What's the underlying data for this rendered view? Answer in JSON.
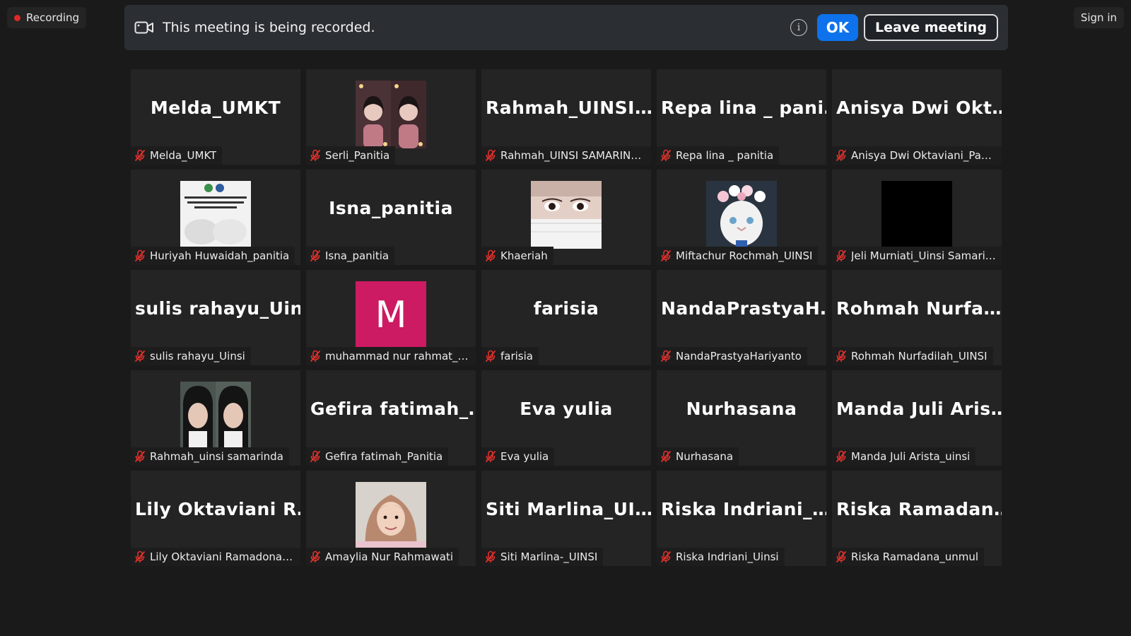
{
  "recording_indicator": {
    "label": "Recording"
  },
  "sign_in": {
    "label": "Sign in"
  },
  "banner": {
    "message": "This meeting is being recorded.",
    "info_glyph": "i",
    "ok_label": "OK",
    "leave_label": "Leave meeting"
  },
  "participants": [
    {
      "name": "Melda_UMKT",
      "display": "Melda_UMKT",
      "avatar": "none"
    },
    {
      "name": "Serli_Panitia",
      "display": "",
      "avatar": "photo-twin-portrait"
    },
    {
      "name": "Rahmah_UINSI SAMARINDA",
      "display": "Rahmah_UINSI…",
      "avatar": "none"
    },
    {
      "name": "Repa lina _ panitia",
      "display": "Repa lina _ pani…",
      "avatar": "none"
    },
    {
      "name": "Anisya Dwi Oktaviani_Panitia",
      "display": "Anisya Dwi Okt…",
      "avatar": "none"
    },
    {
      "name": "Huriyah Huwaidah_panitia",
      "display": "",
      "avatar": "photo-poster"
    },
    {
      "name": "Isna_panitia",
      "display": "Isna_panitia",
      "avatar": "none"
    },
    {
      "name": "Khaeriah",
      "display": "",
      "avatar": "photo-masked-face"
    },
    {
      "name": "Miftachur Rochmah_UINSI",
      "display": "",
      "avatar": "photo-cat-flowers"
    },
    {
      "name": "Jeli Murniati_Uinsi Samarinda",
      "display": "",
      "avatar": "photo-black"
    },
    {
      "name": "sulis rahayu_Uinsi",
      "display": "sulis rahayu_Uinsi",
      "avatar": "none"
    },
    {
      "name": "muhammad nur rahmat_uinsi",
      "display": "",
      "avatar": "letter",
      "letter": "M"
    },
    {
      "name": "farisia",
      "display": "farisia",
      "avatar": "none"
    },
    {
      "name": "NandaPrastyaHariyanto",
      "display": "NandaPrastyaH…",
      "avatar": "none"
    },
    {
      "name": "Rohmah Nurfadilah_UINSI",
      "display": "Rohmah  Nurfa…",
      "avatar": "none"
    },
    {
      "name": "Rahmah_uinsi samarinda",
      "display": "",
      "avatar": "photo-twin-selfie"
    },
    {
      "name": "Gefira fatimah_Panitia",
      "display": "Gefira  fatimah_…",
      "avatar": "none"
    },
    {
      "name": "Eva yulia",
      "display": "Eva yulia",
      "avatar": "none"
    },
    {
      "name": "Nurhasana",
      "display": "Nurhasana",
      "avatar": "none"
    },
    {
      "name": "Manda Juli Arista_uinsi",
      "display": "Manda Juli Aris…",
      "avatar": "none"
    },
    {
      "name": "Lily Oktaviani Ramadona_UI...",
      "display": "Lily Oktaviani R…",
      "avatar": "none"
    },
    {
      "name": "Amaylia Nur Rahmawati",
      "display": "",
      "avatar": "photo-hijab-portrait"
    },
    {
      "name": "Siti Marlina-_UINSI",
      "display": "Siti  Marlina_UI…",
      "avatar": "none"
    },
    {
      "name": "Riska Indriani_Uinsi",
      "display": "Riska  Indriani_…",
      "avatar": "none"
    },
    {
      "name": "Riska Ramadana_unmul",
      "display": "Riska  Ramadan…",
      "avatar": "none"
    }
  ],
  "colors": {
    "background": "#1a1a1a",
    "tile": "#242424",
    "accent_blue": "#0e72ed",
    "muted_red": "#e02828",
    "letter_avatar": "#cc1a63"
  },
  "icons": {
    "recording": "red-dot",
    "camera": "video-camera-icon",
    "info": "info-icon",
    "muted": "microphone-muted-icon"
  }
}
